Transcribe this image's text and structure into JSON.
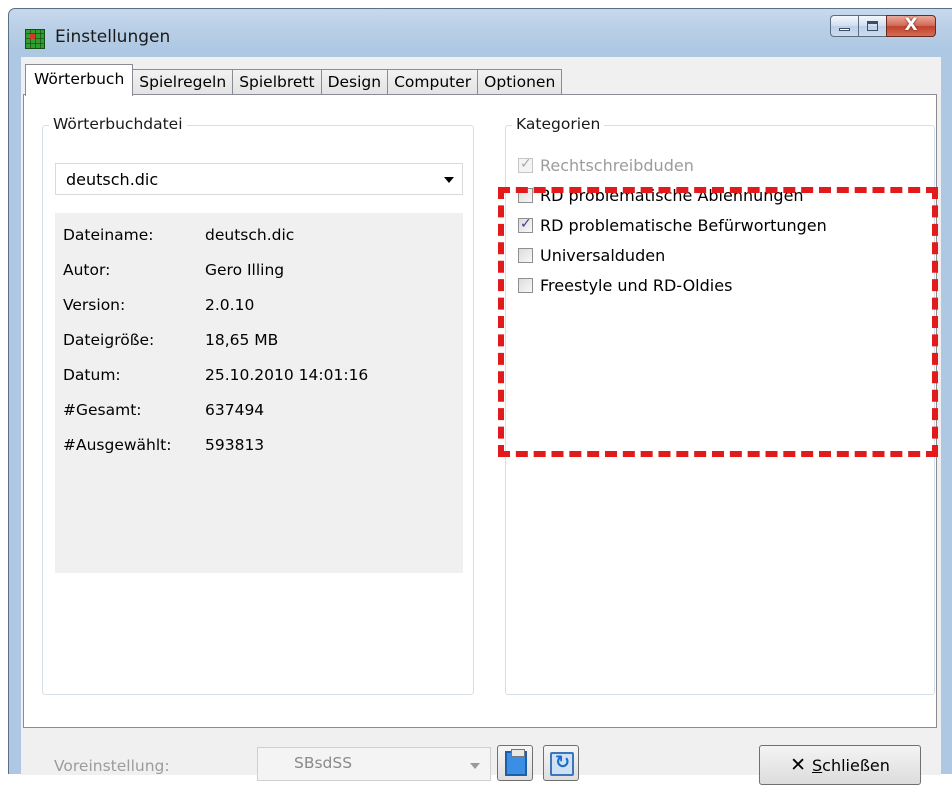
{
  "window": {
    "title": "Einstellungen",
    "close_glyph": "X"
  },
  "tabs": [
    {
      "label": "Wörterbuch",
      "active": true
    },
    {
      "label": "Spielregeln"
    },
    {
      "label": "Spielbrett"
    },
    {
      "label": "Design"
    },
    {
      "label": "Computer"
    },
    {
      "label": "Optionen"
    }
  ],
  "dictionary": {
    "group_title": "Wörterbuchdatei",
    "selected_file": "deutsch.dic",
    "info": [
      {
        "label": "Dateiname:",
        "value": "deutsch.dic"
      },
      {
        "label": "Autor:",
        "value": "Gero Illing"
      },
      {
        "label": "Version:",
        "value": "2.0.10"
      },
      {
        "label": "Dateigröße:",
        "value": "18,65 MB"
      },
      {
        "label": "Datum:",
        "value": "25.10.2010 14:01:16"
      },
      {
        "label": "#Gesamt:",
        "value": "637494"
      },
      {
        "label": "#Ausgewählt:",
        "value": "593813"
      }
    ]
  },
  "categories": {
    "group_title": "Kategorien",
    "items": [
      {
        "label": "Rechtschreibduden",
        "checked": true,
        "disabled": true
      },
      {
        "label": "RD problematische Ablehnungen",
        "checked": false,
        "disabled": false
      },
      {
        "label": "RD problematische Befürwortungen",
        "checked": true,
        "disabled": false
      },
      {
        "label": "Universalduden",
        "checked": false,
        "disabled": false
      },
      {
        "label": "Freestyle und RD-Oldies",
        "checked": false,
        "disabled": false
      }
    ]
  },
  "footer": {
    "preset_label": "Voreinstellung:",
    "preset_value": "SBsdSS",
    "close_label_underlined": "S",
    "close_label_rest": "chließen"
  },
  "colors": {
    "highlight": "#e31a1c"
  }
}
